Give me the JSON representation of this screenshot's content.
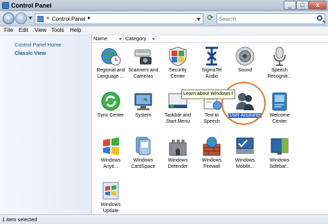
{
  "window": {
    "title": "Control Panel",
    "minimize": "_",
    "maximize": "□",
    "close": "x"
  },
  "address": {
    "path": "Control Panel",
    "separator": "«",
    "arrow": "▸"
  },
  "search": {
    "placeholder": "Search"
  },
  "menu": [
    "File",
    "Edit",
    "View",
    "Tools",
    "Help"
  ],
  "sidebar": {
    "links": [
      "Control Panel Home",
      "Classic View"
    ]
  },
  "columns": [
    "Name",
    "Category"
  ],
  "items": [
    {
      "label": "Regional and\nLanguage ...",
      "icon": "globe-clock-icon"
    },
    {
      "label": "Scanners and\nCameras",
      "icon": "scanner-camera-icon"
    },
    {
      "label": "Security\nCenter",
      "icon": "security-shield-icon"
    },
    {
      "label": "SigmaTel\nAudio",
      "icon": "sigmatel-audio-icon"
    },
    {
      "label": "Sound",
      "icon": "speaker-icon"
    },
    {
      "label": "Speech\nRecogniti...",
      "icon": "microphone-icon"
    },
    {
      "label": "Sync Center",
      "icon": "sync-icon"
    },
    {
      "label": "System",
      "icon": "system-computer-icon"
    },
    {
      "label": "Taskbar and\nStart Menu",
      "icon": "taskbar-icon"
    },
    {
      "label": "Text to\nSpeech",
      "icon": "text-to-speech-icon"
    },
    {
      "label": "User Accounts",
      "icon": "users-icon",
      "selected": true
    },
    {
      "label": "Welcome\nCenter",
      "icon": "welcome-center-icon"
    },
    {
      "label": "Windows\nAnyti...",
      "icon": "windows-anytime-icon"
    },
    {
      "label": "Windows\nCardSpace",
      "icon": "cardspace-icon"
    },
    {
      "label": "Windows\nDefender",
      "icon": "defender-castle-icon"
    },
    {
      "label": "Windows\nFirewall",
      "icon": "firewall-icon"
    },
    {
      "label": "Windows\nMobilit...",
      "icon": "mobility-icon"
    },
    {
      "label": "Windows\nSidebar...",
      "icon": "sidebar-gadget-icon"
    },
    {
      "label": "Windows\nUpdate",
      "icon": "windows-update-icon"
    }
  ],
  "tooltip": "Learn about Windows f",
  "status": "1 item selected",
  "colors": {
    "link": "#1e4fa0",
    "selection": "#3168c6",
    "highlight_ring": "#e0752a"
  }
}
